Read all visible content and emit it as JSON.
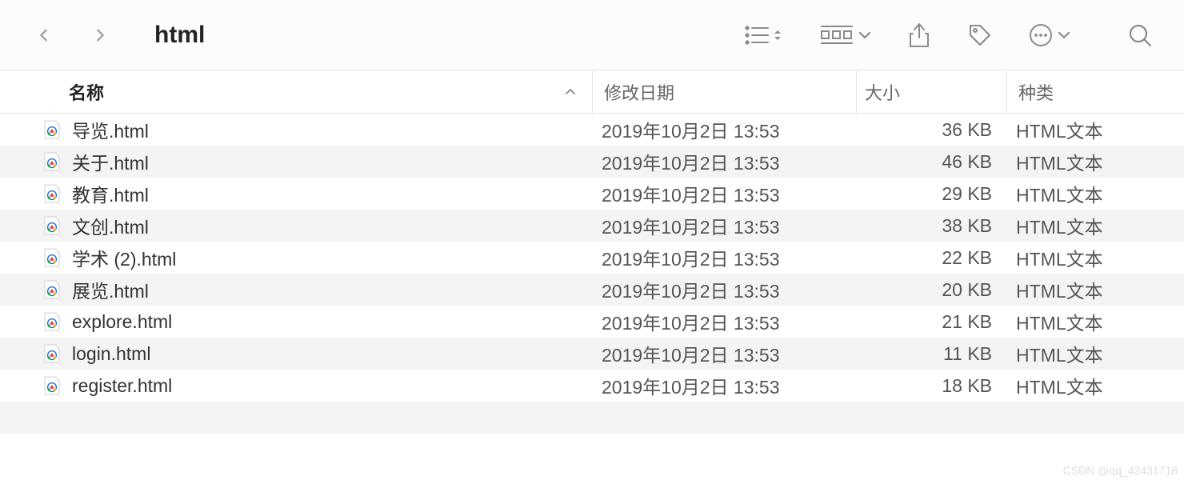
{
  "toolbar": {
    "folder_title": "html"
  },
  "headers": {
    "name": "名称",
    "date": "修改日期",
    "size": "大小",
    "kind": "种类"
  },
  "files": [
    {
      "name": "导览.html",
      "date": "2019年10月2日 13:53",
      "size": "36 KB",
      "kind": "HTML文本"
    },
    {
      "name": "关于.html",
      "date": "2019年10月2日 13:53",
      "size": "46 KB",
      "kind": "HTML文本"
    },
    {
      "name": "教育.html",
      "date": "2019年10月2日 13:53",
      "size": "29 KB",
      "kind": "HTML文本"
    },
    {
      "name": "文创.html",
      "date": "2019年10月2日 13:53",
      "size": "38 KB",
      "kind": "HTML文本"
    },
    {
      "name": "学术 (2).html",
      "date": "2019年10月2日 13:53",
      "size": "22 KB",
      "kind": "HTML文本"
    },
    {
      "name": "展览.html",
      "date": "2019年10月2日 13:53",
      "size": "20 KB",
      "kind": "HTML文本"
    },
    {
      "name": "explore.html",
      "date": "2019年10月2日 13:53",
      "size": "21 KB",
      "kind": "HTML文本"
    },
    {
      "name": "login.html",
      "date": "2019年10月2日 13:53",
      "size": "11 KB",
      "kind": "HTML文本"
    },
    {
      "name": "register.html",
      "date": "2019年10月2日 13:53",
      "size": "18 KB",
      "kind": "HTML文本"
    }
  ],
  "watermark": "CSDN @qq_42431718"
}
